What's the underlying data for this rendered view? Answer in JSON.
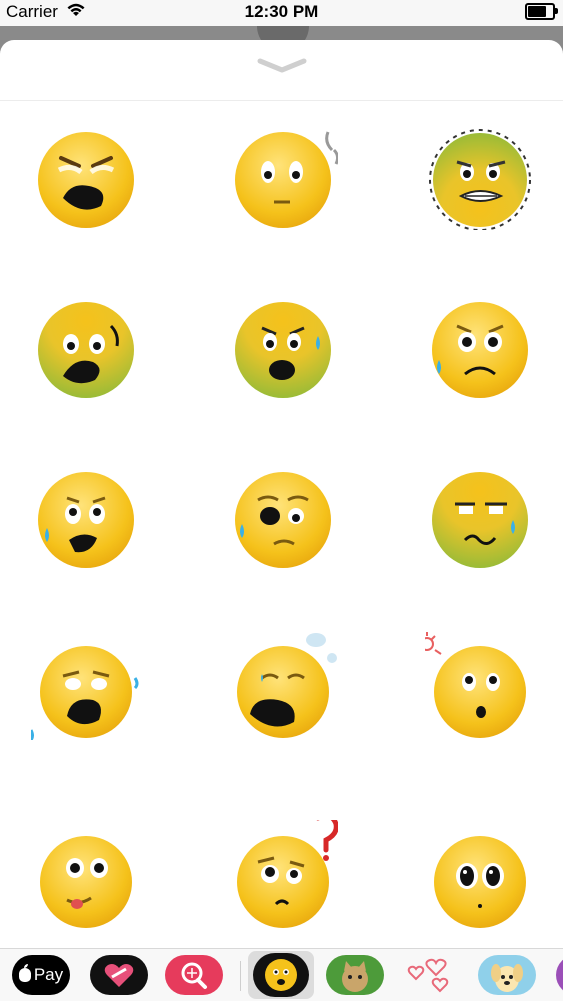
{
  "status_bar": {
    "carrier": "Carrier",
    "time": "12:30 PM",
    "battery_level": 0.8
  },
  "sheet": {
    "grabber_icon": "chevron-down-icon"
  },
  "stickers": [
    {
      "name": "sticker-frustrated"
    },
    {
      "name": "sticker-shocked-blank"
    },
    {
      "name": "sticker-nauseous"
    },
    {
      "name": "sticker-scared-green"
    },
    {
      "name": "sticker-alarmed-green"
    },
    {
      "name": "sticker-sad-sweat"
    },
    {
      "name": "sticker-worried-open-mouth"
    },
    {
      "name": "sticker-uneasy-sweat"
    },
    {
      "name": "sticker-sick-squint"
    },
    {
      "name": "sticker-crying-wail"
    },
    {
      "name": "sticker-sleepy-yawn"
    },
    {
      "name": "sticker-surprised-dizzy"
    },
    {
      "name": "sticker-silly-tongue"
    },
    {
      "name": "sticker-confused-question"
    },
    {
      "name": "sticker-puppy-eyes"
    }
  ],
  "app_drawer": {
    "apple_pay_label": "Pay",
    "apps": [
      "apple-pay-app",
      "heart-app",
      "search-app",
      "emoji-sticker-app",
      "cat-sticker-app",
      "hearts-sticker-app",
      "dog-sticker-app",
      "purple-app"
    ]
  },
  "colors": {
    "face_yellow": "#f5c21b",
    "face_green": "#8fbe3a",
    "sweat_blue": "#3ab0e6",
    "apple_pay_bg": "#000000",
    "search_app_bg": "#e63b5c"
  }
}
